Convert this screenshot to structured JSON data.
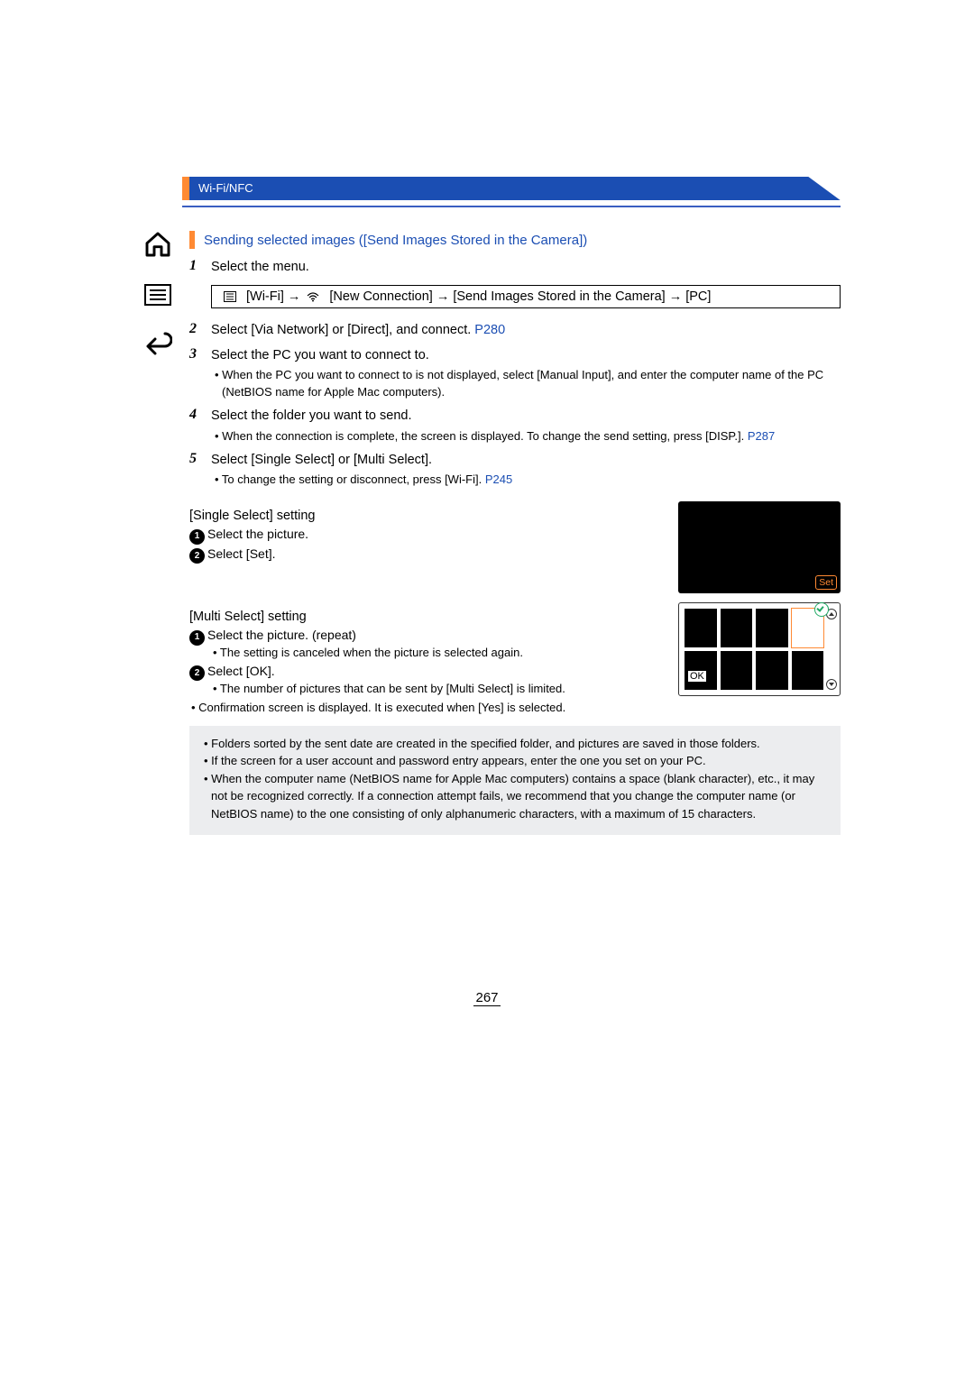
{
  "header": {
    "breadcrumb": "Wi-Fi/NFC"
  },
  "section_title": "Sending selected images ([Send Images Stored in the Camera])",
  "steps": [
    {
      "n": "1",
      "text": "Select the menu.",
      "menu_path": {
        "a": "[Wi-Fi]",
        "b": "[New Connection]",
        "c": "[Send Images Stored in the Camera]",
        "d": "[PC]"
      }
    },
    {
      "n": "2",
      "text": "Select [Via Network] or [Direct], and connect. ",
      "link": "P280"
    },
    {
      "n": "3",
      "text": "Select the PC you want to connect to.",
      "sub": "• When the PC you want to connect to is not displayed, select [Manual Input], and enter the computer name of the PC (NetBIOS name for Apple Mac computers)."
    },
    {
      "n": "4",
      "text": "Select the folder you want to send.",
      "sub_a": "• When the connection is complete, the screen is displayed. To change the send setting, press [DISP.]. ",
      "sub_link": "P287"
    },
    {
      "n": "5",
      "text": "Select [Single Select] or [Multi Select].",
      "sub_a": "• To change the setting or disconnect, press [Wi-Fi]. ",
      "sub_link": "P245"
    }
  ],
  "single": {
    "heading": "[Single Select] setting",
    "items": [
      "Select the picture.",
      "Select [Set]."
    ],
    "set_label": "Set"
  },
  "multi": {
    "heading": "[Multi Select] setting",
    "items": [
      {
        "main": "Select the picture. (repeat)",
        "sub": "• The setting is canceled when the picture is selected again."
      },
      {
        "main": "Select [OK].",
        "sub": "• The number of pictures that can be sent by [Multi Select] is limited."
      }
    ],
    "ok_label": "OK",
    "confirm": "• Confirmation screen is displayed. It is executed when [Yes] is selected."
  },
  "notes": [
    "• Folders sorted by the sent date are created in the specified folder, and pictures are saved in those folders.",
    "• If the screen for a user account and password entry appears, enter the one you set on your PC.",
    "• When the computer name (NetBIOS name for Apple Mac computers) contains a space (blank character), etc., it may not be recognized correctly. If a connection attempt fails, we recommend that you change the computer name (or NetBIOS name) to the one consisting of only alphanumeric characters, with a maximum of 15 characters."
  ],
  "page_number": "267"
}
